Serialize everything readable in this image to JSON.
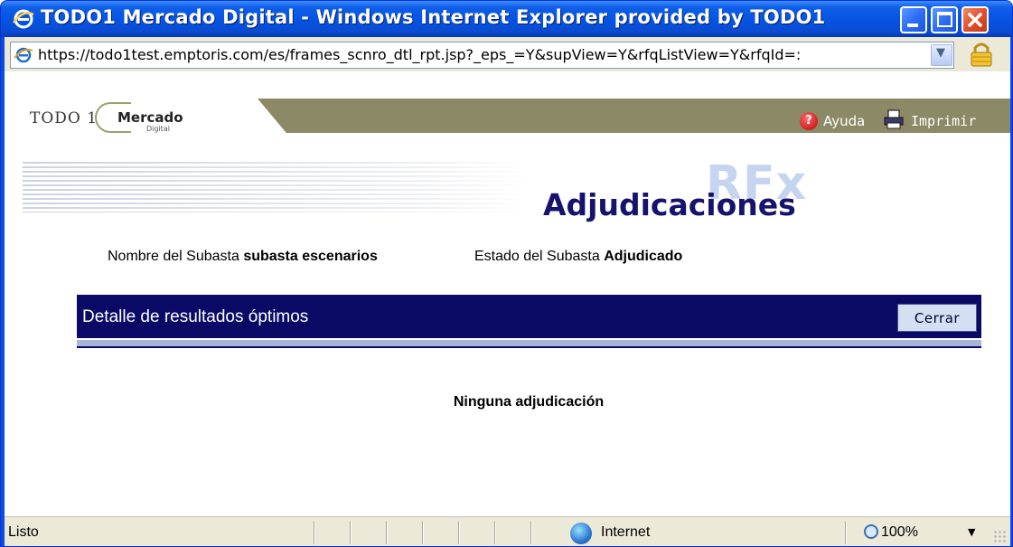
{
  "window": {
    "title": "TODO1 Mercado Digital - Windows Internet Explorer provided by TODO1"
  },
  "address": {
    "url": "https://todo1test.emptoris.com/es/frames_scnro_dtl_rpt.jsp?_eps_=Y&supView=Y&rfqListView=Y&rfqId=:"
  },
  "header": {
    "logo_todo": "TODO 1",
    "logo_mercado": "Mercado",
    "logo_digital": "Digital",
    "help_label": "Ayuda",
    "print_label": "Imprimir"
  },
  "page": {
    "watermark": "RFx",
    "title": "Adjudicaciones",
    "auction_name_label": "Nombre del Subasta",
    "auction_name_value": "subasta escenarios",
    "auction_state_label": "Estado del Subasta",
    "auction_state_value": "Adjudicado",
    "detail_title": "Detalle de resultados óptimos",
    "close_label": "Cerrar",
    "empty_message": "Ninguna adjudicación"
  },
  "statusbar": {
    "status": "Listo",
    "zone": "Internet",
    "zoom": "100%"
  },
  "colors": {
    "title_navy": "#16136e",
    "detail_bar": "#0a0a66",
    "header_olive": "#8c8a66",
    "xp_blue": "#0553e1"
  }
}
